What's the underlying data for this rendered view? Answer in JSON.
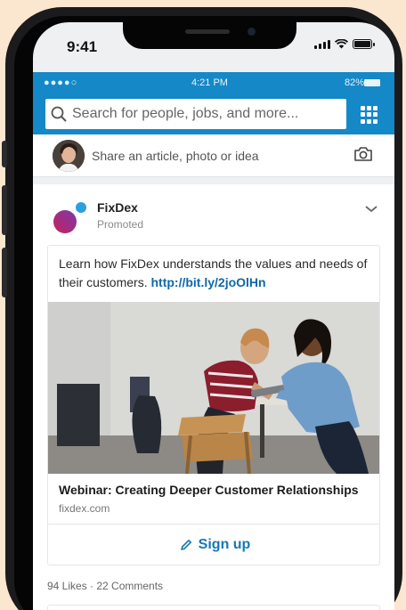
{
  "status_bar": {
    "time": "9:41"
  },
  "app_status": {
    "carrier": "●●●●○",
    "time": "4:21 PM",
    "battery": "82%"
  },
  "search": {
    "placeholder": "Search for people, jobs, and more..."
  },
  "share": {
    "prompt": "Share an article, photo or idea"
  },
  "post": {
    "brand": "FixDex",
    "label": "Promoted",
    "text": "Learn how FixDex understands the values and needs of their customers.",
    "link": "http://bit.ly/2joOlHn",
    "headline": "Webinar: Creating Deeper Customer Relationships",
    "domain": "fixdex.com",
    "cta": "Sign up",
    "stats": "94 Likes · 22 Comments"
  },
  "colors": {
    "app_blue": "#1588c8",
    "link_blue": "#1068a8",
    "cta_blue": "#1678b5",
    "background": "#fbe7cf"
  },
  "icons": [
    "search-icon",
    "grid-icon",
    "camera-icon",
    "chevron-down-icon",
    "pencil-icon",
    "wifi-icon",
    "signal-icon",
    "battery-icon"
  ]
}
